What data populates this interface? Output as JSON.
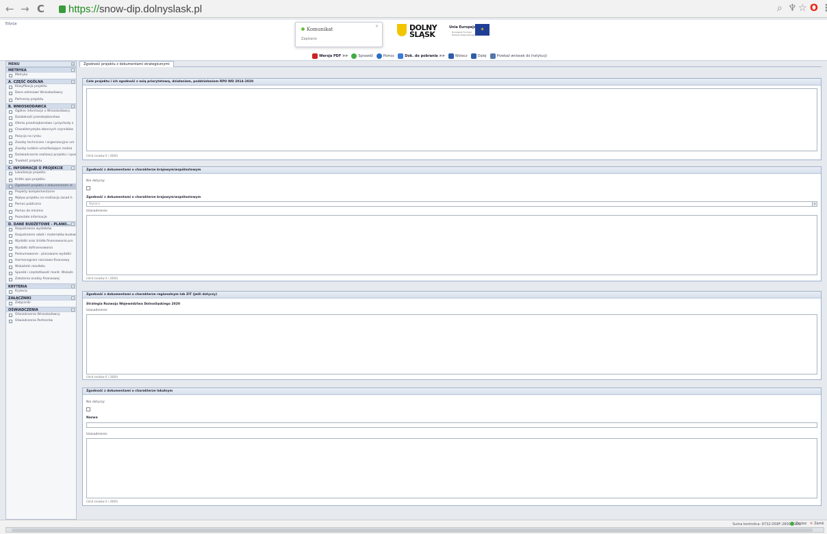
{
  "browser": {
    "back": "←",
    "forward": "→",
    "reload": "C",
    "url_scheme": "https://",
    "url_host": "snow-dip.dolnyslask.pl",
    "icons": [
      "search-icon",
      "pin-icon",
      "star-icon",
      "opera-icon",
      "menu-icon"
    ]
  },
  "app": {
    "mode_label": "Edycja"
  },
  "toast": {
    "title": "Komunikat",
    "message": "Zapisano",
    "close": "×"
  },
  "logos": {
    "ds_line1": "DOLNY",
    "ds_line2": "ŚLĄSK",
    "eu_title": "Unia Europejska",
    "eu_sub1": "Europejski Fundusz",
    "eu_sub2": "Rozwoju Regionalnego"
  },
  "toolbar": {
    "pdf": "Wersja PDF >>",
    "validate": "Sprawdź",
    "help": "Pomoc",
    "docs": "Dok. do pobrania >>",
    "back": "Wstecz",
    "next": "Dalej",
    "submit": "Przekaż wniosek do Instytucji"
  },
  "menu": {
    "title": "MENU",
    "sections": [
      {
        "title": "METRYKA",
        "items": [
          "Metryka"
        ]
      },
      {
        "title": "A. CZĘŚĆ OGÓLNA",
        "items": [
          "Klasyfikacja projektu",
          "Dane adresowe Wnioskodawcy",
          "Partnerzy projektu"
        ]
      },
      {
        "title": "B. WNIOSKODAWCA",
        "items": [
          "Ogólne informacje o Wnioskodawcy",
          "Działalność przedsiębiorstwa",
          "Oferta przedsiębiorstwa i przychody z",
          "Charakterystyka obecnych czynników",
          "Pozycja na rynku",
          "Zasoby techniczne i organizacyjne um",
          "Zasoby ludzkie umożliwiające realiza",
          "Doświadczenie realizacji projektu i sposo",
          "Trwałość projektu"
        ]
      },
      {
        "title": "C. INFORMACJE O PROJEKCIE",
        "items": [
          "Lokalizacja projektu",
          "Krótki opis projektu",
          "Zgodność projektu z dokumentami st",
          "Projekty komplementarne",
          "Wpływ projektu na realizację zasad h",
          "Pomoc publiczna",
          "Pomoc de minimis",
          "Pozostałe informacje"
        ]
      },
      {
        "title": "D. DANE BUDŻETOWE - PLANO...",
        "items": [
          "Rozpatrzenie wydatków",
          "Rozpatrzenie robót i materiałów budowlany",
          "Wydatki oraz źródła finansowania pro",
          "Wydatki dofinansowania",
          "Podsumowanie - planowane wydatki",
          "Harmonogram rzeczowo-finansowy",
          "Wskaźniki rezultatu",
          "Sposób i częstotliwość monit. Wskaźn",
          "Założenia analizy finansowej"
        ]
      },
      {
        "title": "KRYTERIA",
        "items": [
          "Kryteria"
        ]
      },
      {
        "title": "ZAŁĄCZNIKI",
        "items": [
          "Załączniki"
        ]
      },
      {
        "title": "OŚWIADCZENIA",
        "items": [
          "Oświadczenia Wnioskodawcy",
          "Oświadczenia Partnerów"
        ]
      }
    ],
    "selected": "Zgodność projektu z dokumentami st"
  },
  "tab": {
    "label": "Zgodność projektu z dokumentami strategicznymi"
  },
  "panels": {
    "p1": {
      "title": "Cele projektu i ich zgodność z osią priorytetową, działaniem, poddziałaniem RPO WD 2014-2020",
      "limit": "(limit znaków 0 / 2000)"
    },
    "p2": {
      "title": "Zgodność z dokumentami o charakterze krajowym/wspólnotowym",
      "nd_label": "Nie dotyczy:",
      "select_label": "Zgodność z dokumentami o charakterze krajowym/wspólnotowym",
      "select_placeholder": "Wybierz",
      "just_label": "Uzasadnienie:",
      "limit": "(limit znaków 0 / 2000)"
    },
    "p3": {
      "title": "Zgodność z dokumentami o charakterze regionalnym lub ZIT (jeśli dotyczy)",
      "strategy": "Strategia Rozwoju Województwa Dolnośląskiego 2020",
      "just_label": "Uzasadnienie:",
      "limit": "(limit znaków 0 / 2000)"
    },
    "p4": {
      "title": "Zgodność z dokumentami o charakterze lokalnym",
      "nd_label": "Nie dotyczy:",
      "name_label": "Nazwa",
      "just_label": "Uzasadnienie:",
      "limit": "(limit znaków 0 / 2000)"
    }
  },
  "status": {
    "checksum": "Suma kontrolna: 9732-D58F-2800-9101",
    "save": "Zapisz",
    "close": "Zamk"
  }
}
